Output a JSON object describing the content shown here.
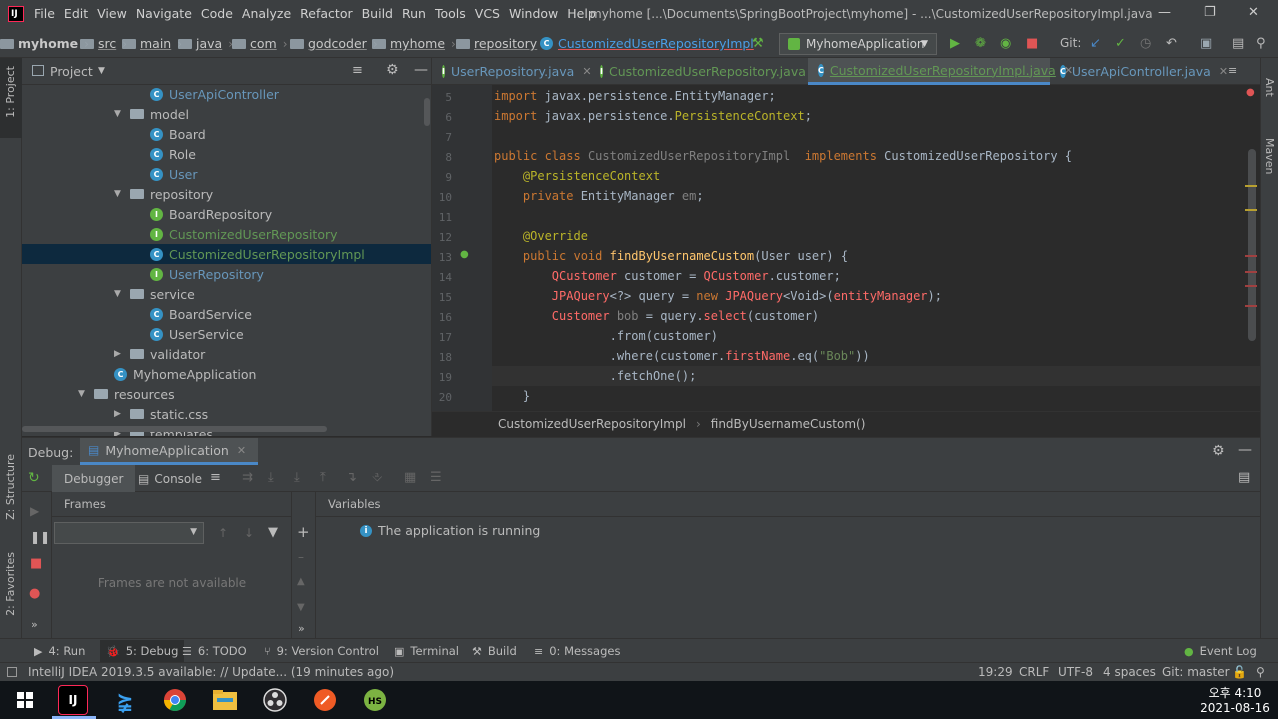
{
  "menubar": {
    "logo": "IJ",
    "items": [
      "File",
      "Edit",
      "View",
      "Navigate",
      "Code",
      "Analyze",
      "Refactor",
      "Build",
      "Run",
      "Tools",
      "VCS",
      "Window",
      "Help"
    ],
    "title": "myhome [...\\Documents\\SpringBootProject\\myhome] - ...\\CustomizedUserRepositoryImpl.java"
  },
  "breadcrumbs": [
    "myhome",
    "src",
    "main",
    "java",
    "com",
    "godcoder",
    "myhome",
    "repository",
    "CustomizedUserRepositoryImpl"
  ],
  "toolbar": {
    "run_config": "MyhomeApplication",
    "git_label": "Git:"
  },
  "project": {
    "title": "Project",
    "tree": [
      {
        "label": "UserApiController",
        "kind": "class",
        "level": 4,
        "color": "#6897bb"
      },
      {
        "label": "model",
        "kind": "folder",
        "level": 3,
        "expanded": true
      },
      {
        "label": "Board",
        "kind": "class",
        "level": 4,
        "color": "#bbbbbb"
      },
      {
        "label": "Role",
        "kind": "class",
        "level": 4,
        "color": "#bbbbbb"
      },
      {
        "label": "User",
        "kind": "class",
        "level": 4,
        "color": "#6897bb"
      },
      {
        "label": "repository",
        "kind": "folder",
        "level": 3,
        "expanded": true
      },
      {
        "label": "BoardRepository",
        "kind": "interface",
        "level": 4,
        "color": "#bbbbbb"
      },
      {
        "label": "CustomizedUserRepository",
        "kind": "interface",
        "level": 4,
        "color": "#629755"
      },
      {
        "label": "CustomizedUserRepositoryImpl",
        "kind": "class",
        "level": 4,
        "color": "#629755"
      },
      {
        "label": "UserRepository",
        "kind": "interface",
        "level": 4,
        "color": "#6897bb"
      },
      {
        "label": "service",
        "kind": "folder",
        "level": 3,
        "expanded": true
      },
      {
        "label": "BoardService",
        "kind": "class",
        "level": 4,
        "color": "#bbbbbb"
      },
      {
        "label": "UserService",
        "kind": "class",
        "level": 4,
        "color": "#bbbbbb"
      },
      {
        "label": "validator",
        "kind": "folder",
        "level": 3,
        "expanded": false
      },
      {
        "label": "MyhomeApplication",
        "kind": "class",
        "level": 3,
        "color": "#bbbbbb"
      },
      {
        "label": "resources",
        "kind": "folder",
        "level": 2,
        "expanded": true
      },
      {
        "label": "static.css",
        "kind": "folder",
        "level": 3,
        "expanded": false
      },
      {
        "label": "templates",
        "kind": "folder",
        "level": 3,
        "expanded": false
      }
    ]
  },
  "tabs": [
    {
      "label": "UserRepository.java",
      "kind": "interface",
      "active": false,
      "color": "#6897bb"
    },
    {
      "label": "CustomizedUserRepository.java",
      "kind": "interface",
      "active": false,
      "color": "#629755"
    },
    {
      "label": "CustomizedUserRepositoryImpl.java",
      "kind": "class",
      "active": true,
      "color": "#629755"
    },
    {
      "label": "UserApiController.java",
      "kind": "class",
      "active": false,
      "color": "#6897bb"
    }
  ],
  "editor": {
    "lines": [
      {
        "n": "5",
        "html": "<span class='kw'>import</span> javax.persistence.EntityManager;"
      },
      {
        "n": "6",
        "html": "<span class='kw'>import</span> javax.persistence.<span class='fn' style='color:#bbb529'>PersistenceContext</span>;"
      },
      {
        "n": "7",
        "html": ""
      },
      {
        "n": "8",
        "html": "<span class='kw'>public class</span> <span class='gray'>CustomizedUserRepositoryImpl</span>  <span class='kw'>implements</span> CustomizedUserRepository {"
      },
      {
        "n": "9",
        "html": "    <span class='ann'>@PersistenceContext</span>"
      },
      {
        "n": "10",
        "html": "    <span class='kw'>private</span> EntityManager <span class='fld' style='color:#808080'>em</span>;"
      },
      {
        "n": "11",
        "html": ""
      },
      {
        "n": "12",
        "html": "    <span class='ann'>@Override</span>"
      },
      {
        "n": "13",
        "html": "    <span class='kw'>public void</span> <span class='fn'>findByUsernameCustom</span>(User user) {"
      },
      {
        "n": "14",
        "html": "        <span class='err'>QCustomer</span> customer = <span class='err'>QCustomer</span>.customer;"
      },
      {
        "n": "15",
        "html": "        <span class='err'>JPAQuery</span>&lt;?&gt; query = <span class='kw'>new</span> <span class='err'>JPAQuery</span>&lt;Void&gt;(<span class='err'>entityManager</span>);"
      },
      {
        "n": "16",
        "html": "        <span class='err'>Customer</span> <span class='gray'>bob</span> = query.<span class='err'>select</span>(customer)"
      },
      {
        "n": "17",
        "html": "                .from(customer)"
      },
      {
        "n": "18",
        "html": "                .where(customer.<span class='err'>firstName</span>.eq(<span class='str'>\"Bob\"</span>))"
      },
      {
        "n": "19",
        "html": "                .fetchOne();"
      },
      {
        "n": "20",
        "html": "    }"
      }
    ],
    "crumbs": [
      "CustomizedUserRepositoryImpl",
      "findByUsernameCustom()"
    ]
  },
  "debug": {
    "label": "Debug:",
    "session": "MyhomeApplication",
    "tabs": [
      "Debugger",
      "Console"
    ],
    "frames_title": "Frames",
    "frames_empty": "Frames are not available",
    "vars_title": "Variables",
    "vars_message": "The application is running"
  },
  "bottom_tools": [
    {
      "label": "4: Run",
      "icon": "▶"
    },
    {
      "label": "5: Debug",
      "icon": "🐞"
    },
    {
      "label": "6: TODO",
      "icon": "☰"
    },
    {
      "label": "9: Version Control",
      "icon": "⑂"
    },
    {
      "label": "Terminal",
      "icon": "▣"
    },
    {
      "label": "Build",
      "icon": "⚒"
    },
    {
      "label": "0: Messages",
      "icon": "≡"
    },
    {
      "label": "Event Log",
      "icon": "●"
    }
  ],
  "side_labels": {
    "project": "1: Project",
    "structure": "Z: Structure",
    "favorites": "2: Favorites",
    "ant": "Ant",
    "maven": "Maven"
  },
  "status": {
    "message": "IntelliJ IDEA 2019.3.5 available: // Update... (19 minutes ago)",
    "position": "19:29",
    "line_sep": "CRLF",
    "encoding": "UTF-8",
    "indent": "4 spaces",
    "git": "Git: master"
  },
  "taskbar": {
    "time": "오후 4:10",
    "date": "2021-08-16"
  }
}
